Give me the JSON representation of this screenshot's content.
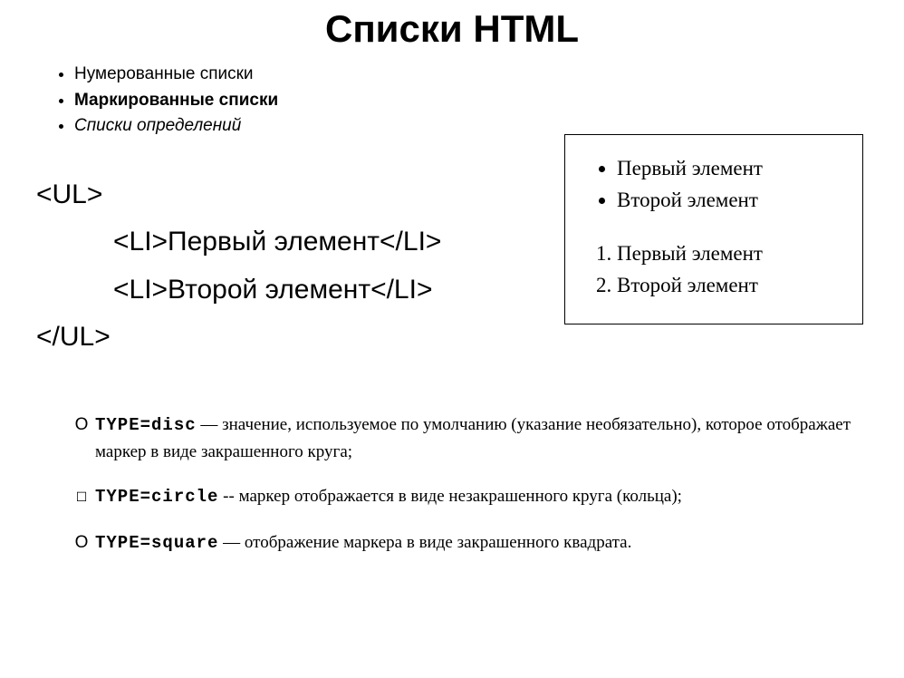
{
  "title": "Списки HTML",
  "topList": {
    "item1": "Нумерованные списки",
    "item2": "Маркированные списки",
    "item3": "Списки определений"
  },
  "code": {
    "openUl": "<UL>",
    "li1": "<LI>Первый элемент</LI>",
    "li2": "<LI>Второй элемент</LI>",
    "closeUl": "</UL>"
  },
  "example": {
    "ul1": "Первый элемент",
    "ul2": "Второй элемент",
    "ol1": "Первый элемент",
    "ol2": "Второй элемент"
  },
  "typeDesc": {
    "disc": {
      "label": "TYPE=disc",
      "text": " — значение, используемое по умолчанию (указание необяза­тельно), которое отображает маркер в виде закрашенного круга;"
    },
    "circle": {
      "label": "TYPE=circle",
      "text": " -- маркер отображается в виде незакрашенного круга (кольца);"
    },
    "square": {
      "label": "TYPE=square",
      "text": " — отображение маркера в виде закрашенного квадрата."
    }
  }
}
